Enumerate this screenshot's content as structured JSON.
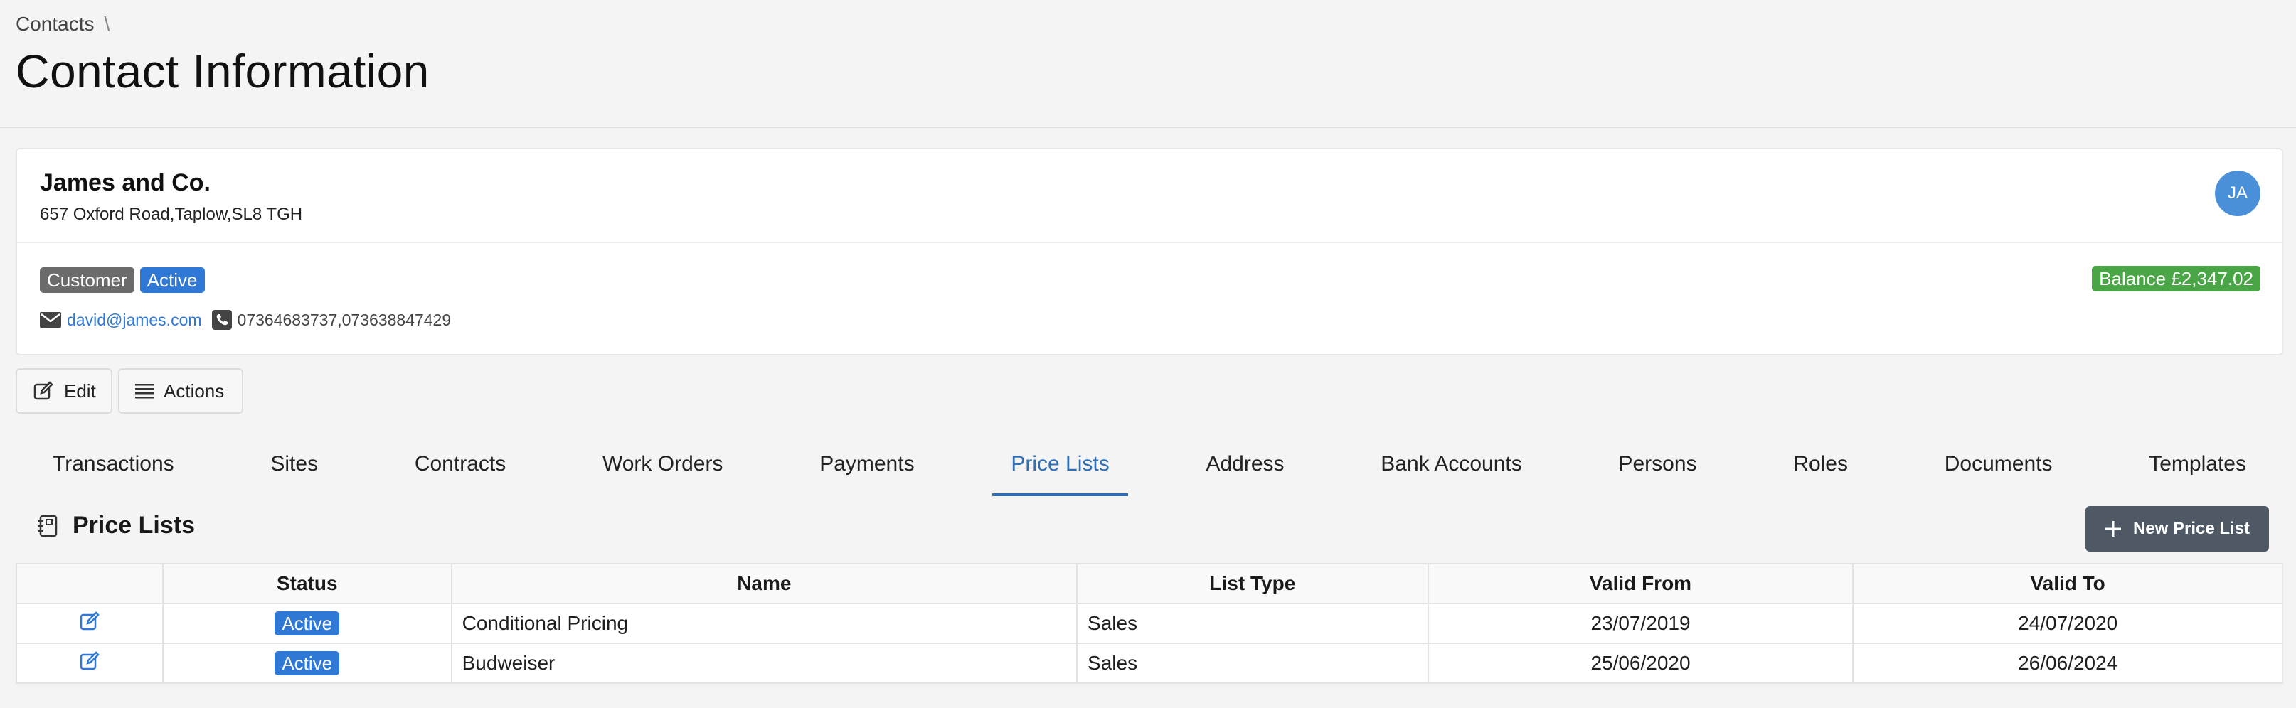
{
  "breadcrumb": {
    "root": "Contacts",
    "separator": "\\"
  },
  "page": {
    "title": "Contact Information"
  },
  "contact": {
    "name": "James and Co.",
    "address": "657 Oxford Road,Taplow,SL8 TGH",
    "avatar_initials": "JA",
    "tags": [
      "Customer",
      "Active"
    ],
    "balance": "Balance £2,347.02",
    "email": "david@james.com",
    "phone": "07364683737,073638847429"
  },
  "toolbar": {
    "edit_label": "Edit",
    "actions_label": "Actions"
  },
  "tabs": [
    {
      "label": "Transactions"
    },
    {
      "label": "Sites"
    },
    {
      "label": "Contracts"
    },
    {
      "label": "Work Orders"
    },
    {
      "label": "Payments"
    },
    {
      "label": "Price Lists",
      "selected": true
    },
    {
      "label": "Address"
    },
    {
      "label": "Bank Accounts"
    },
    {
      "label": "Persons"
    },
    {
      "label": "Roles"
    },
    {
      "label": "Documents"
    },
    {
      "label": "Templates"
    }
  ],
  "section": {
    "title": "Price Lists",
    "new_button": "New Price List"
  },
  "table": {
    "columns": [
      "",
      "Status",
      "Name",
      "List Type",
      "Valid From",
      "Valid To"
    ],
    "rows": [
      {
        "status": "Active",
        "name": "Conditional Pricing",
        "list_type": "Sales",
        "valid_from": "23/07/2019",
        "valid_to": "24/07/2020"
      },
      {
        "status": "Active",
        "name": "Budweiser",
        "list_type": "Sales",
        "valid_from": "25/06/2020",
        "valid_to": "26/06/2024"
      }
    ]
  },
  "icons": {
    "edit": "edit-icon",
    "actions": "list-icon",
    "email": "mail-icon",
    "phone": "phone-icon",
    "section": "notebook-icon",
    "new": "plus-icon",
    "row_edit": "edit-icon"
  },
  "colors": {
    "accent": "#2f78d6",
    "tab_selected": "#2f6fb8",
    "balance": "#4aa547",
    "customer_tag": "#6b6b6b",
    "new_button": "#4f5966",
    "avatar": "#4a90d9"
  }
}
